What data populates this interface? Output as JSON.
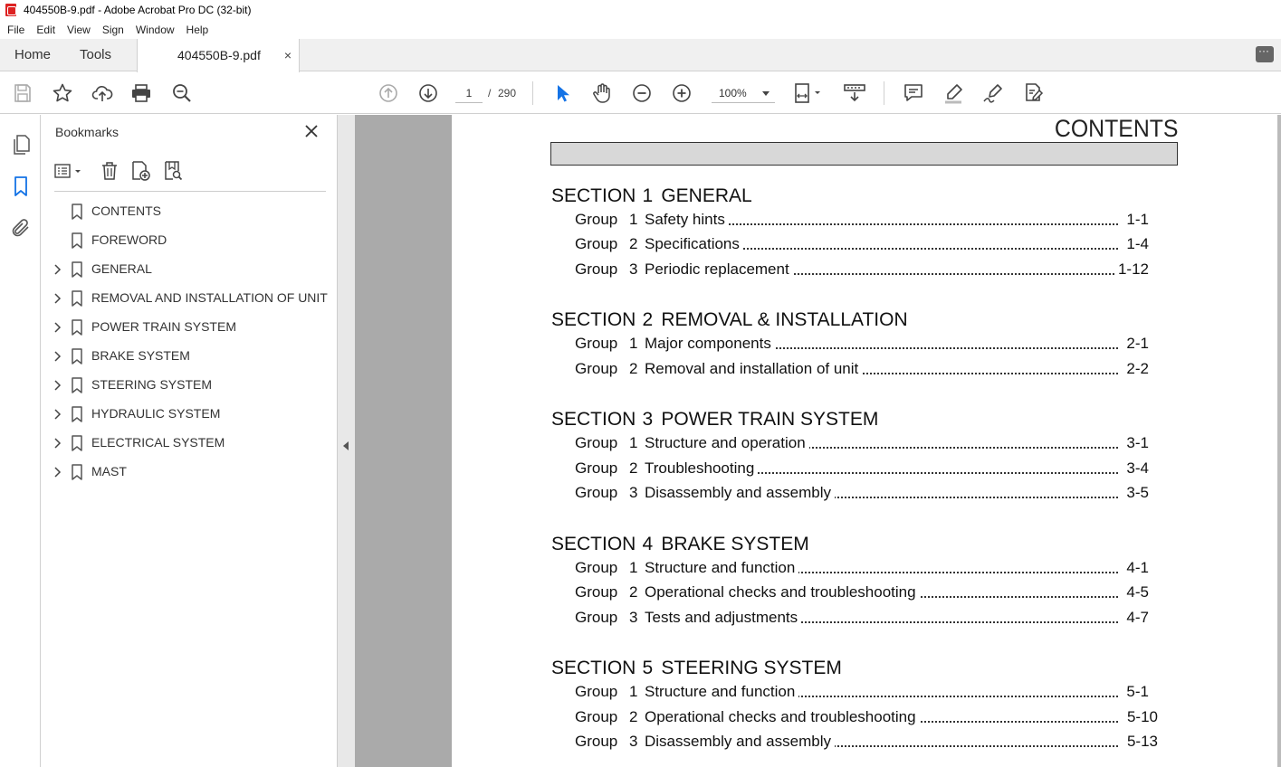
{
  "window": {
    "title": "404550B-9.pdf - Adobe Acrobat Pro DC (32-bit)"
  },
  "menu": [
    "File",
    "Edit",
    "View",
    "Sign",
    "Window",
    "Help"
  ],
  "tabs": {
    "home": "Home",
    "tools": "Tools",
    "doc": "404550B-9.pdf",
    "close": "×"
  },
  "toolbar": {
    "page_current": "1",
    "page_sep": "/",
    "page_total": "290",
    "zoom": "100%"
  },
  "colors": {
    "accent": "#1473e6",
    "brand": "#d22c2c"
  },
  "bookmarks": {
    "title": "Bookmarks",
    "items": [
      {
        "label": "CONTENTS",
        "expandable": false
      },
      {
        "label": "FOREWORD",
        "expandable": false
      },
      {
        "label": "GENERAL",
        "expandable": true
      },
      {
        "label": "REMOVAL AND INSTALLATION OF UNIT",
        "expandable": true
      },
      {
        "label": "POWER TRAIN SYSTEM",
        "expandable": true
      },
      {
        "label": "BRAKE SYSTEM",
        "expandable": true
      },
      {
        "label": "STEERING SYSTEM",
        "expandable": true
      },
      {
        "label": "HYDRAULIC SYSTEM",
        "expandable": true
      },
      {
        "label": "ELECTRICAL SYSTEM",
        "expandable": true
      },
      {
        "label": "MAST",
        "expandable": true
      }
    ]
  },
  "document": {
    "heading": "CONTENTS",
    "sections": [
      {
        "word": "SECTION",
        "num": "1",
        "title": "GENERAL",
        "groups": [
          {
            "word": "Group",
            "num": "1",
            "title": "Safety hints",
            "page": "1-1"
          },
          {
            "word": "Group",
            "num": "2",
            "title": "Specifications",
            "page": "1-4"
          },
          {
            "word": "Group",
            "num": "3",
            "title": "Periodic replacement",
            "page": "1-12"
          }
        ]
      },
      {
        "word": "SECTION",
        "num": "2",
        "title": "REMOVAL & INSTALLATION",
        "groups": [
          {
            "word": "Group",
            "num": "1",
            "title": "Major components",
            "page": "2-1"
          },
          {
            "word": "Group",
            "num": "2",
            "title": "Removal and installation of unit",
            "page": "2-2"
          }
        ]
      },
      {
        "word": "SECTION",
        "num": "3",
        "title": "POWER TRAIN SYSTEM",
        "groups": [
          {
            "word": "Group",
            "num": "1",
            "title": "Structure and operation",
            "page": "3-1"
          },
          {
            "word": "Group",
            "num": "2",
            "title": "Troubleshooting",
            "page": "3-4"
          },
          {
            "word": "Group",
            "num": "3",
            "title": "Disassembly and assembly",
            "page": "3-5"
          }
        ]
      },
      {
        "word": "SECTION",
        "num": "4",
        "title": "BRAKE SYSTEM",
        "groups": [
          {
            "word": "Group",
            "num": "1",
            "title": "Structure and function",
            "page": "4-1"
          },
          {
            "word": "Group",
            "num": "2",
            "title": "Operational checks and troubleshooting",
            "page": "4-5"
          },
          {
            "word": "Group",
            "num": "3",
            "title": "Tests and adjustments",
            "page": "4-7"
          }
        ]
      },
      {
        "word": "SECTION",
        "num": "5",
        "title": "STEERING SYSTEM",
        "groups": [
          {
            "word": "Group",
            "num": "1",
            "title": "Structure and function",
            "page": "5-1"
          },
          {
            "word": "Group",
            "num": "2",
            "title": "Operational checks and troubleshooting",
            "page": "5-10"
          },
          {
            "word": "Group",
            "num": "3",
            "title": "Disassembly and assembly",
            "page": "5-13"
          }
        ]
      }
    ]
  }
}
